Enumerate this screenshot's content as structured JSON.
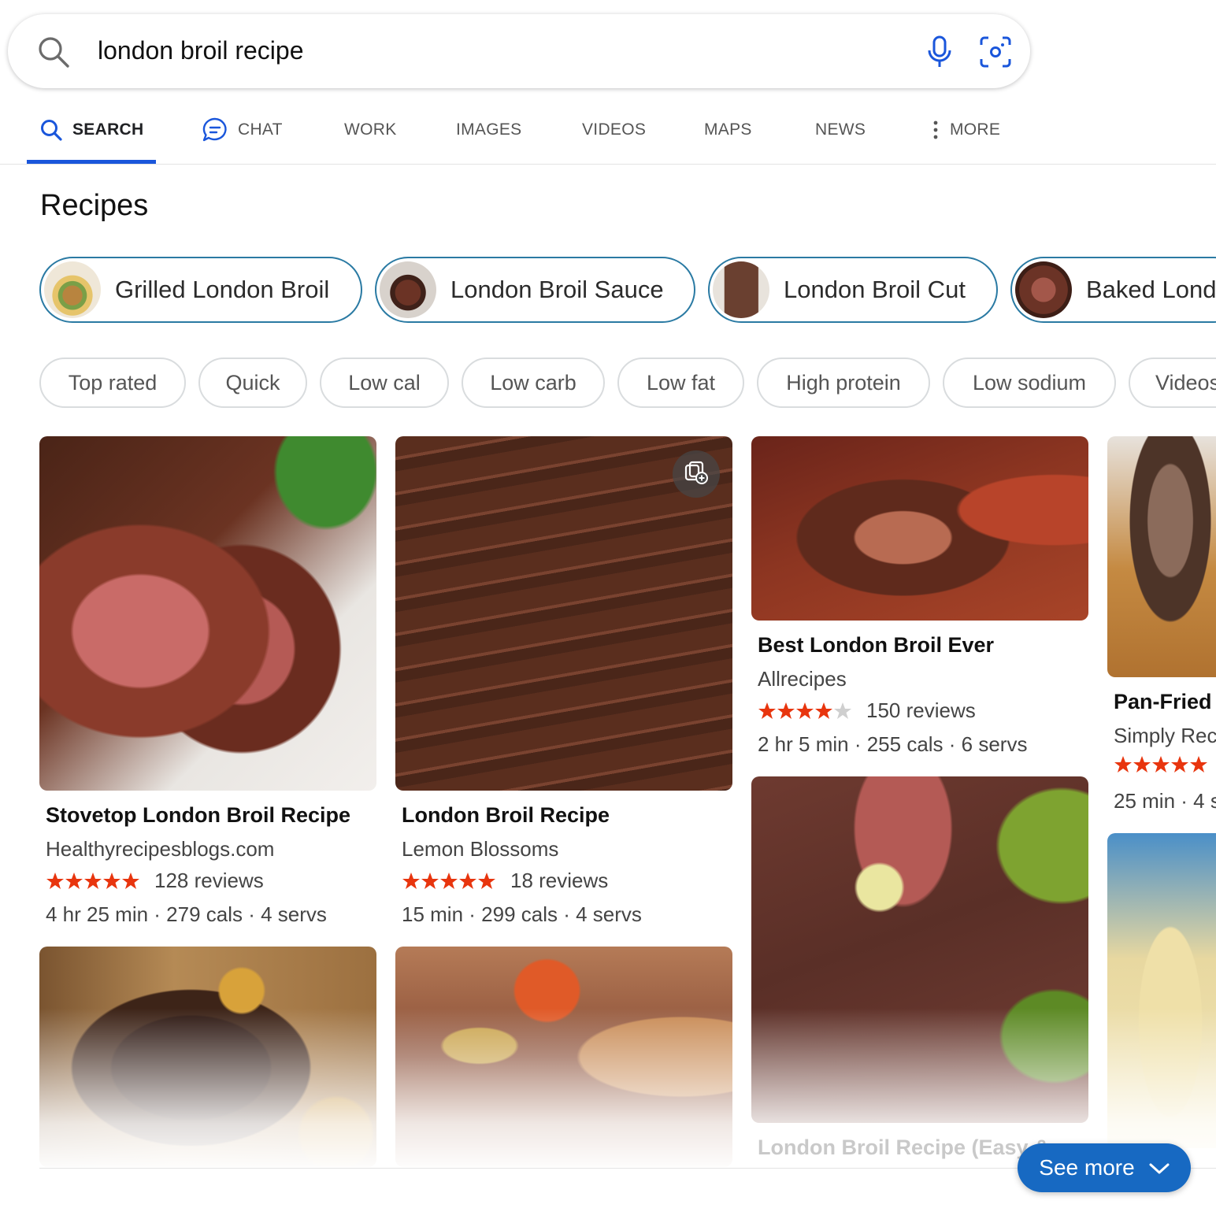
{
  "search": {
    "query": "london broil recipe",
    "icons": [
      "search-icon",
      "microphone-icon",
      "visual-search-icon"
    ]
  },
  "tabs": [
    {
      "label": "SEARCH",
      "icon": "search-icon",
      "active": true
    },
    {
      "label": "CHAT",
      "icon": "chat-icon",
      "active": false
    },
    {
      "label": "WORK",
      "active": false
    },
    {
      "label": "IMAGES",
      "active": false
    },
    {
      "label": "VIDEOS",
      "active": false
    },
    {
      "label": "MAPS",
      "active": false
    },
    {
      "label": "NEWS",
      "active": false
    },
    {
      "label": "MORE",
      "icon": "more-vertical-icon",
      "active": false
    }
  ],
  "section_title": "Recipes",
  "related": [
    {
      "label": "Grilled London Broil"
    },
    {
      "label": "London Broil Sauce"
    },
    {
      "label": "London Broil Cut"
    },
    {
      "label": "Baked Lond"
    }
  ],
  "filters": [
    "Top rated",
    "Quick",
    "Low cal",
    "Low carb",
    "Low fat",
    "High protein",
    "Low sodium",
    "Videos"
  ],
  "cards": [
    {
      "title": "Stovetop London Broil Recipe",
      "source": "Healthyrecipesblogs.com",
      "rating": 5,
      "reviews": "128 reviews",
      "meta": "4 hr 25 min · 279 cals · 4 servs"
    },
    {
      "title": "London Broil Recipe",
      "source": "Lemon Blossoms",
      "rating": 5,
      "reviews": "18 reviews",
      "meta": "15 min · 299 cals · 4 servs"
    },
    {
      "title": "Best London Broil Ever",
      "source": "Allrecipes",
      "rating": 4,
      "reviews": "150 reviews",
      "meta": "2 hr 5 min · 255 cals · 6 servs"
    },
    {
      "title": "Pan-Fried",
      "source": "Simply Reci",
      "rating": 5,
      "reviews": "",
      "meta": "25 min · 4 s"
    },
    {
      "title": "London Broil Recipe (Easy &",
      "source": "",
      "rating": null,
      "reviews": "",
      "meta": ""
    }
  ],
  "see_more": "See more",
  "colors": {
    "accent": "#1a56db",
    "pill_border": "#2a7aa3",
    "star": "#e8350e",
    "star_empty": "#cfcfcf",
    "see_more_bg": "#1769c2"
  }
}
